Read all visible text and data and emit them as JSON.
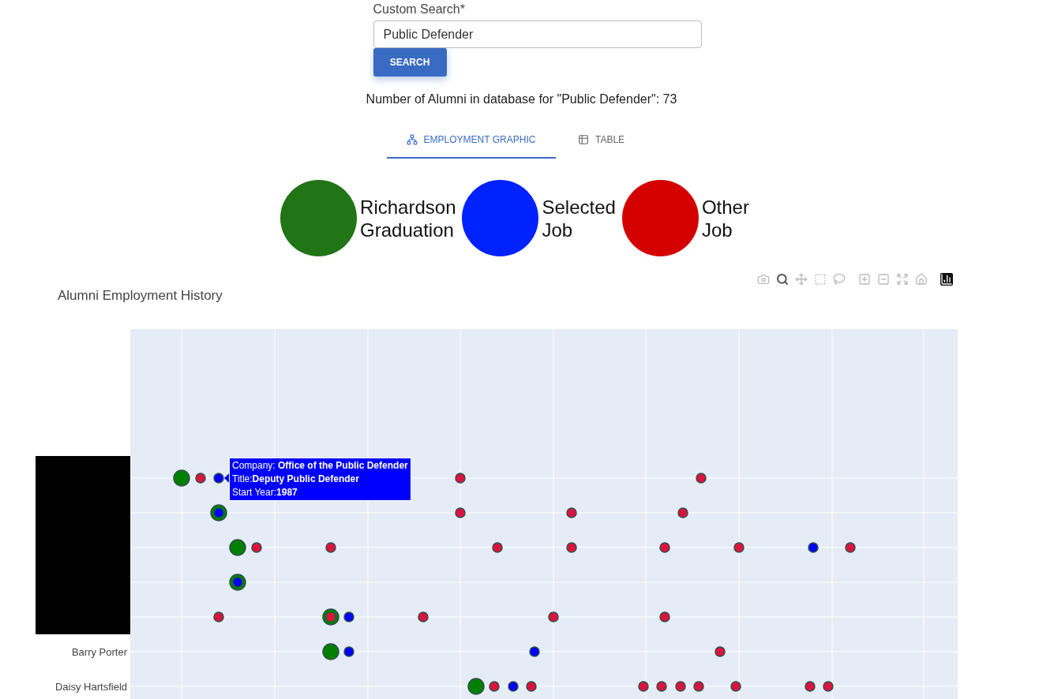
{
  "search": {
    "label": "Custom Search*",
    "value": "Public Defender",
    "button": "SEARCH"
  },
  "count_text": "Number of Alumni in database for \"Public Defender\": 73",
  "tabs": [
    {
      "label": "EMPLOYMENT GRAPHIC",
      "kind": "graph",
      "selected": true
    },
    {
      "label": "TABLE",
      "kind": "table",
      "selected": false
    }
  ],
  "legend": [
    {
      "label": "Richardson\nGraduation",
      "color": "#217516"
    },
    {
      "label": "Selected\nJob",
      "color": "#0022ff"
    },
    {
      "label": "Other\nJob",
      "color": "#d40000"
    }
  ],
  "chart": {
    "title": "Alumni Employment History",
    "modebar": [
      {
        "kind": "camera",
        "selected": false
      },
      {
        "kind": "zoom",
        "selected": true
      },
      {
        "kind": "pan",
        "selected": false
      },
      {
        "kind": "box",
        "selected": false
      },
      {
        "kind": "lasso",
        "selected": false
      },
      {
        "kind": "zoomin",
        "selected": false
      },
      {
        "kind": "zoomout",
        "selected": false
      },
      {
        "kind": "autoscale",
        "selected": false
      },
      {
        "kind": "home",
        "selected": false
      },
      {
        "kind": "logo",
        "selected": false
      }
    ],
    "row_labels": [
      "Barry Porter",
      "Daisy Hartsfield"
    ],
    "tooltip": [
      "Company: **Office of the Public Defender**",
      "Title:**Deputy Public Defender**",
      "Start Year:**1987**"
    ]
  }
}
